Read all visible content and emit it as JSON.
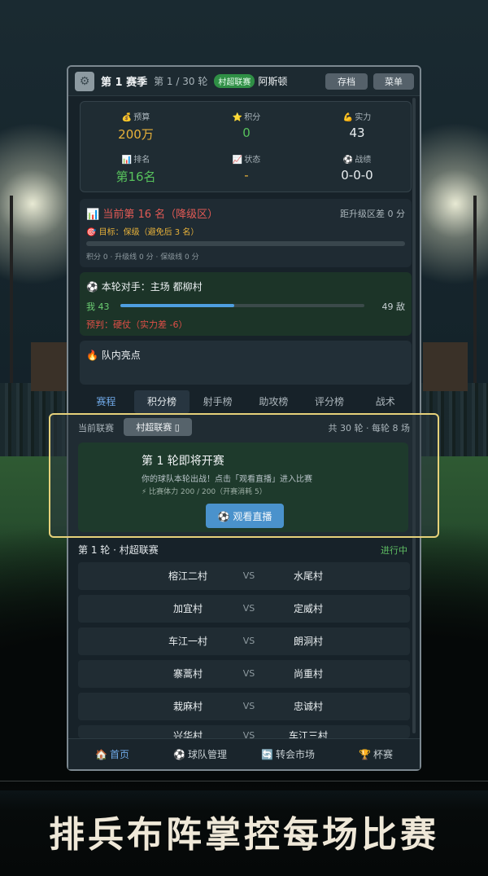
{
  "header": {
    "season": "第 1 赛季",
    "round": "第 1 / 30 轮",
    "league_badge": "村超联赛",
    "team": "阿斯顿",
    "save_label": "存档",
    "menu_label": "菜单"
  },
  "stats": [
    {
      "icon": "💰",
      "label": "预算",
      "value": "200万",
      "color": "#e8b23a"
    },
    {
      "icon": "⭐",
      "label": "积分",
      "value": "0",
      "color": "#57c25c"
    },
    {
      "icon": "💪",
      "label": "实力",
      "value": "43",
      "color": "#e9eef0"
    },
    {
      "icon": "📊",
      "label": "排名",
      "value": "第16名",
      "color": "#57c25c"
    },
    {
      "icon": "📈",
      "label": "状态",
      "value": "-",
      "color": "#e8b23a"
    },
    {
      "icon": "⚽",
      "label": "战绩",
      "value": "0-0-0",
      "color": "#e9eef0"
    }
  ],
  "rank_card": {
    "title": "📊 当前第 16 名（降级区）",
    "gap": "距升级区差 0 分",
    "goal": "🎯 目标：保级（避免后 3 名）",
    "points_line": "积分 0 · 升级线 0 分 · 保级线 0 分"
  },
  "opponent_card": {
    "title": "⚽ 本轮对手：主场 都柳村",
    "me": "我 43",
    "them": "49 敌",
    "strength_ratio": 0.467,
    "prediction": "预判：硬仗（实力差 -6）"
  },
  "highlights": {
    "title": "🔥 队内亮点"
  },
  "tabs": [
    "赛程",
    "积分榜",
    "射手榜",
    "助攻榜",
    "评分榜",
    "战术"
  ],
  "league_bar": {
    "current_label": "当前联赛",
    "league": "村超联赛 ▯",
    "info": "共 30 轮 · 每轮 8 场"
  },
  "start_card": {
    "heading": "第 1 轮即将开赛",
    "sub": "你的球队本轮出战！点击「观看直播」进入比赛",
    "stamina": "⚡ 比赛体力 200 / 200（开赛消耗 5）",
    "watch": "⚽ 观看直播"
  },
  "matches_header": {
    "title": "第 1 轮 · 村超联赛",
    "status": "进行中"
  },
  "matches": [
    {
      "home": "榕江二村",
      "vs": "VS",
      "away": "水尾村"
    },
    {
      "home": "加宜村",
      "vs": "VS",
      "away": "定威村"
    },
    {
      "home": "车江一村",
      "vs": "VS",
      "away": "朗洞村"
    },
    {
      "home": "寨蒿村",
      "vs": "VS",
      "away": "尚重村"
    },
    {
      "home": "栽麻村",
      "vs": "VS",
      "away": "忠诚村"
    },
    {
      "home": "兴华村",
      "vs": "VS",
      "away": "车江三村"
    }
  ],
  "bottom_nav": [
    {
      "icon": "🏠",
      "label": "首页"
    },
    {
      "icon": "⚽",
      "label": "球队管理"
    },
    {
      "icon": "🔄",
      "label": "转会市场"
    },
    {
      "icon": "🏆",
      "label": "杯赛"
    }
  ],
  "caption": "排兵布阵掌控每场比赛"
}
